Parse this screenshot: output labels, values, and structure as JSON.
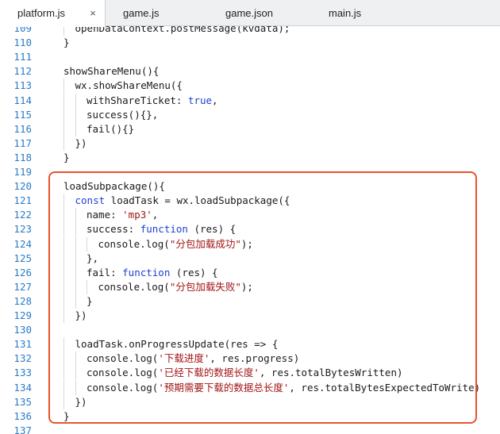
{
  "tabs": [
    {
      "label": "platform.js",
      "active": true,
      "close": "×"
    },
    {
      "label": "game.js",
      "active": false
    },
    {
      "label": "game.json",
      "active": false
    },
    {
      "label": "main.js",
      "active": false
    }
  ],
  "lines": [
    {
      "n": "109",
      "indent": 1,
      "parts": [
        {
          "t": "openDataContext.postMessage(kvdata);"
        }
      ]
    },
    {
      "n": "110",
      "indent": 0,
      "parts": [
        {
          "t": "}"
        }
      ]
    },
    {
      "n": "111",
      "indent": 0,
      "parts": []
    },
    {
      "n": "112",
      "indent": 0,
      "parts": [
        {
          "t": "showShareMenu(){"
        }
      ]
    },
    {
      "n": "113",
      "indent": 1,
      "parts": [
        {
          "t": "wx.showShareMenu({"
        }
      ]
    },
    {
      "n": "114",
      "indent": 2,
      "parts": [
        {
          "t": "withShareTicket: "
        },
        {
          "t": "true",
          "c": "kw"
        },
        {
          "t": ","
        }
      ]
    },
    {
      "n": "115",
      "indent": 2,
      "parts": [
        {
          "t": "success(){},"
        }
      ]
    },
    {
      "n": "116",
      "indent": 2,
      "parts": [
        {
          "t": "fail(){}"
        }
      ]
    },
    {
      "n": "117",
      "indent": 1,
      "parts": [
        {
          "t": "})"
        }
      ]
    },
    {
      "n": "118",
      "indent": 0,
      "parts": [
        {
          "t": "}"
        }
      ]
    },
    {
      "n": "119",
      "indent": 0,
      "parts": []
    },
    {
      "n": "120",
      "indent": 0,
      "parts": [
        {
          "t": "loadSubpackage(){"
        }
      ]
    },
    {
      "n": "121",
      "indent": 1,
      "parts": [
        {
          "t": "const",
          "c": "kw"
        },
        {
          "t": " loadTask = wx.loadSubpackage({"
        }
      ]
    },
    {
      "n": "122",
      "indent": 2,
      "parts": [
        {
          "t": "name: "
        },
        {
          "t": "'mp3'",
          "c": "str"
        },
        {
          "t": ","
        }
      ]
    },
    {
      "n": "123",
      "indent": 2,
      "parts": [
        {
          "t": "success: "
        },
        {
          "t": "function",
          "c": "kw"
        },
        {
          "t": " (res) {"
        }
      ]
    },
    {
      "n": "124",
      "indent": 3,
      "parts": [
        {
          "t": "console.log("
        },
        {
          "t": "\"分包加载成功\"",
          "c": "str"
        },
        {
          "t": ");"
        }
      ]
    },
    {
      "n": "125",
      "indent": 2,
      "parts": [
        {
          "t": "},"
        }
      ]
    },
    {
      "n": "126",
      "indent": 2,
      "parts": [
        {
          "t": "fail: "
        },
        {
          "t": "function",
          "c": "kw"
        },
        {
          "t": " (res) {"
        }
      ]
    },
    {
      "n": "127",
      "indent": 3,
      "parts": [
        {
          "t": "console.log("
        },
        {
          "t": "\"分包加载失败\"",
          "c": "str"
        },
        {
          "t": ");"
        }
      ]
    },
    {
      "n": "128",
      "indent": 2,
      "parts": [
        {
          "t": "}"
        }
      ]
    },
    {
      "n": "129",
      "indent": 1,
      "parts": [
        {
          "t": "})"
        }
      ]
    },
    {
      "n": "130",
      "indent": 0,
      "parts": []
    },
    {
      "n": "131",
      "indent": 1,
      "parts": [
        {
          "t": "loadTask.onProgressUpdate(res => {"
        }
      ]
    },
    {
      "n": "132",
      "indent": 2,
      "parts": [
        {
          "t": "console.log("
        },
        {
          "t": "'下载进度'",
          "c": "str"
        },
        {
          "t": ", res.progress)"
        }
      ]
    },
    {
      "n": "133",
      "indent": 2,
      "parts": [
        {
          "t": "console.log("
        },
        {
          "t": "'已经下载的数据长度'",
          "c": "str"
        },
        {
          "t": ", res.totalBytesWritten)"
        }
      ]
    },
    {
      "n": "134",
      "indent": 2,
      "parts": [
        {
          "t": "console.log("
        },
        {
          "t": "'预期需要下载的数据总长度'",
          "c": "str"
        },
        {
          "t": ", res.totalBytesExpectedToWrite)"
        }
      ]
    },
    {
      "n": "135",
      "indent": 1,
      "parts": [
        {
          "t": "})"
        }
      ]
    },
    {
      "n": "136",
      "indent": 0,
      "parts": [
        {
          "t": "}"
        }
      ]
    },
    {
      "n": "137",
      "indent": 0,
      "parts": []
    }
  ]
}
